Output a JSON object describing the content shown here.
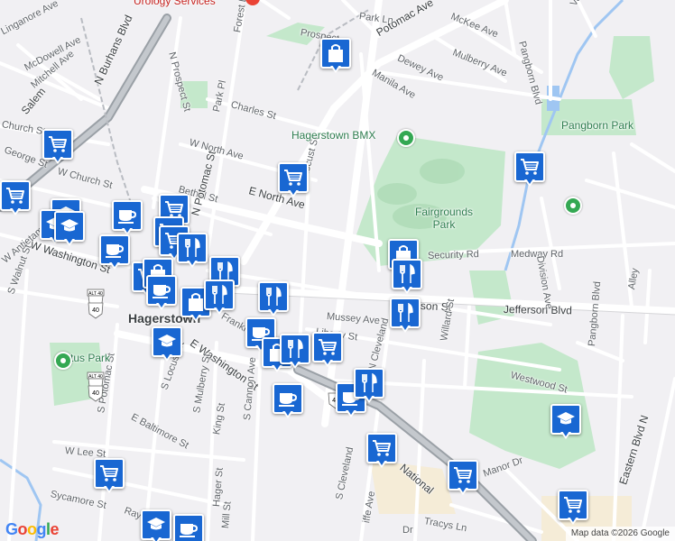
{
  "map": {
    "attribution": "Map data ©2026 Google",
    "logo_text": "Google",
    "partial_top_label": "Urology Services",
    "city_label": "Hagerstown",
    "parks": [
      {
        "id": "fairgrounds",
        "label": "Fairgrounds\nPark"
      },
      {
        "id": "pangborn",
        "label": "Pangborn Park"
      },
      {
        "id": "city",
        "label": "tus Park"
      }
    ],
    "pois": [
      {
        "id": "bmx",
        "label": "Hagerstown BMX"
      }
    ],
    "route_shields": [
      "ALT 40",
      "40",
      "ALT 40",
      "40",
      "40"
    ],
    "streets": [
      "Park Ln",
      "Potomac Ave",
      "McKee Ave",
      "Prospect",
      "Dewey Ave",
      "Mulberry Ave",
      "Pangborn Blvd",
      "Manila Ave",
      "Valley",
      "Linganore Ave",
      "McDowell Ave",
      "Mitchell Ave",
      "Salem",
      "N Burhans Blvd",
      "N Prospect St",
      "Forest Dr",
      "Charles St",
      "W North Ave",
      "Park Pl",
      "Church St",
      "George St",
      "W Church St",
      "Bethel St",
      "E North Ave",
      "Locust St",
      "N Potomac St",
      "W Washington St",
      "W Antietam St",
      "S Walnut St",
      "Hagers",
      "E Washington St",
      "S Potomac St",
      "S Locust St",
      "S Mulberry St",
      "King St",
      "S Cannon Ave",
      "E Baltimore St",
      "W Lee St",
      "Sycamore St",
      "Ray",
      "Hager St",
      "Mill St",
      "Mussey Ave",
      "Liberty St",
      "Jefferson Blvd",
      "son St",
      "Security Rd",
      "Medway Rd",
      "Division Ave",
      "Willard St",
      "Westwood St",
      "Pangborn Blvd",
      "Alley",
      "Eastern Blvd N",
      "S Cleveland",
      "National",
      "Manor Dr",
      "Tracys Ln",
      "iffe Ave",
      "Dr",
      "N Cleveland",
      "Frankl"
    ],
    "marker_types": [
      "shopping-bag-icon",
      "grocery-cart-icon",
      "coffee-cup-icon",
      "restaurant-icon",
      "school-icon"
    ]
  }
}
